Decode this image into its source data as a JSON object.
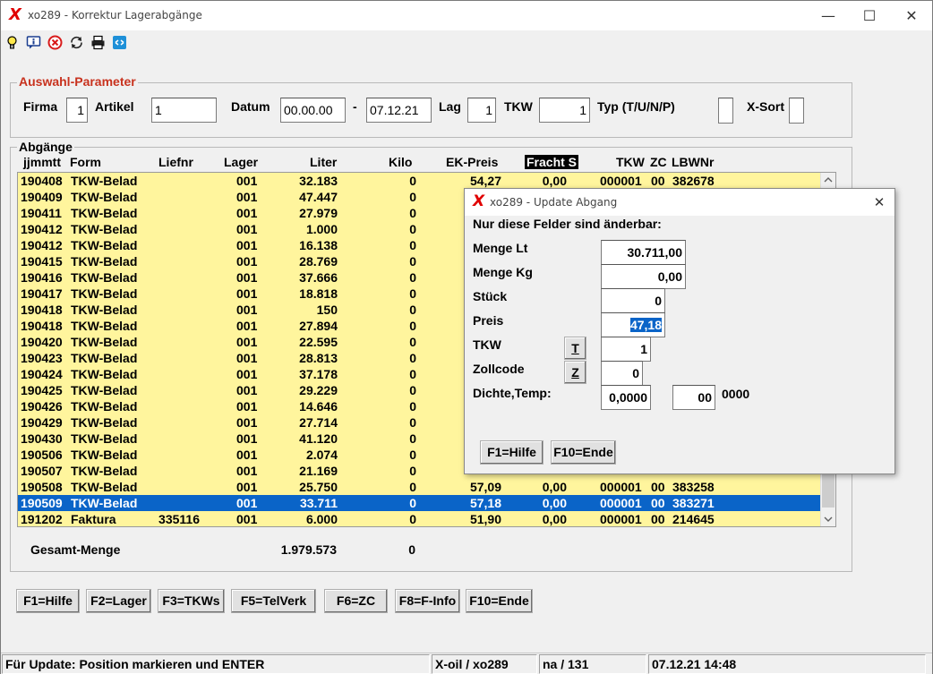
{
  "window": {
    "title": "xo289 - Korrektur Lagerabgänge",
    "logo": "X",
    "controls": {
      "minimize": "—",
      "maximize": "☐",
      "close": "✕"
    }
  },
  "toolbar": {
    "icons": [
      "lightbulb-icon",
      "info-icon",
      "stop-icon",
      "refresh-icon",
      "printer-icon",
      "settings-icon"
    ]
  },
  "auswahl": {
    "title": "Auswahl-Parameter",
    "firma_label": "Firma",
    "firma_value": "1",
    "artikel_label": "Artikel",
    "artikel_value": "1",
    "datum_label": "Datum",
    "datum_from": "00.00.00",
    "datum_sep": "-",
    "datum_to": "07.12.21",
    "lag_label": "Lag",
    "lag_value": "1",
    "tkw_label": "TKW",
    "tkw_value": "1",
    "typ_label": "Typ (T/U/N/P)",
    "typ_value": "",
    "xsort_label": "X-Sort",
    "xsort_value": ""
  },
  "abgaenge": {
    "title": "Abgänge",
    "headers": {
      "date": "jjmmtt",
      "form": "Form",
      "liefnr": "Liefnr",
      "lager": "Lager",
      "liter": "Liter",
      "kilo": "Kilo",
      "ekpreis": "EK-Preis",
      "fracht": "Fracht  S",
      "tkw": "TKW",
      "zc": "ZC",
      "lbwnr": "LBWNr"
    },
    "rows": [
      {
        "date": "190408",
        "form": "TKW-Belad",
        "liefnr": "",
        "lager": "001",
        "liter": "32.183",
        "kilo": "0",
        "ekpreis": "54,27",
        "fracht": "0,00",
        "tkw": "000001",
        "zc": "00",
        "lbwnr": "382678"
      },
      {
        "date": "190409",
        "form": "TKW-Belad",
        "liefnr": "",
        "lager": "001",
        "liter": "47.447",
        "kilo": "0",
        "ekpreis": "",
        "fracht": "",
        "tkw": "",
        "zc": "",
        "lbwnr": ""
      },
      {
        "date": "190411",
        "form": "TKW-Belad",
        "liefnr": "",
        "lager": "001",
        "liter": "27.979",
        "kilo": "0",
        "ekpreis": "",
        "fracht": "",
        "tkw": "",
        "zc": "",
        "lbwnr": ""
      },
      {
        "date": "190412",
        "form": "TKW-Belad",
        "liefnr": "",
        "lager": "001",
        "liter": "1.000",
        "kilo": "0",
        "ekpreis": "",
        "fracht": "",
        "tkw": "",
        "zc": "",
        "lbwnr": ""
      },
      {
        "date": "190412",
        "form": "TKW-Belad",
        "liefnr": "",
        "lager": "001",
        "liter": "16.138",
        "kilo": "0",
        "ekpreis": "",
        "fracht": "",
        "tkw": "",
        "zc": "",
        "lbwnr": ""
      },
      {
        "date": "190415",
        "form": "TKW-Belad",
        "liefnr": "",
        "lager": "001",
        "liter": "28.769",
        "kilo": "0",
        "ekpreis": "",
        "fracht": "",
        "tkw": "",
        "zc": "",
        "lbwnr": ""
      },
      {
        "date": "190416",
        "form": "TKW-Belad",
        "liefnr": "",
        "lager": "001",
        "liter": "37.666",
        "kilo": "0",
        "ekpreis": "",
        "fracht": "",
        "tkw": "",
        "zc": "",
        "lbwnr": ""
      },
      {
        "date": "190417",
        "form": "TKW-Belad",
        "liefnr": "",
        "lager": "001",
        "liter": "18.818",
        "kilo": "0",
        "ekpreis": "",
        "fracht": "",
        "tkw": "",
        "zc": "",
        "lbwnr": ""
      },
      {
        "date": "190418",
        "form": "TKW-Belad",
        "liefnr": "",
        "lager": "001",
        "liter": "150",
        "kilo": "0",
        "ekpreis": "",
        "fracht": "",
        "tkw": "",
        "zc": "",
        "lbwnr": ""
      },
      {
        "date": "190418",
        "form": "TKW-Belad",
        "liefnr": "",
        "lager": "001",
        "liter": "27.894",
        "kilo": "0",
        "ekpreis": "",
        "fracht": "",
        "tkw": "",
        "zc": "",
        "lbwnr": ""
      },
      {
        "date": "190420",
        "form": "TKW-Belad",
        "liefnr": "",
        "lager": "001",
        "liter": "22.595",
        "kilo": "0",
        "ekpreis": "",
        "fracht": "",
        "tkw": "",
        "zc": "",
        "lbwnr": ""
      },
      {
        "date": "190423",
        "form": "TKW-Belad",
        "liefnr": "",
        "lager": "001",
        "liter": "28.813",
        "kilo": "0",
        "ekpreis": "",
        "fracht": "",
        "tkw": "",
        "zc": "",
        "lbwnr": ""
      },
      {
        "date": "190424",
        "form": "TKW-Belad",
        "liefnr": "",
        "lager": "001",
        "liter": "37.178",
        "kilo": "0",
        "ekpreis": "",
        "fracht": "",
        "tkw": "",
        "zc": "",
        "lbwnr": ""
      },
      {
        "date": "190425",
        "form": "TKW-Belad",
        "liefnr": "",
        "lager": "001",
        "liter": "29.229",
        "kilo": "0",
        "ekpreis": "",
        "fracht": "",
        "tkw": "",
        "zc": "",
        "lbwnr": ""
      },
      {
        "date": "190426",
        "form": "TKW-Belad",
        "liefnr": "",
        "lager": "001",
        "liter": "14.646",
        "kilo": "0",
        "ekpreis": "",
        "fracht": "",
        "tkw": "",
        "zc": "",
        "lbwnr": ""
      },
      {
        "date": "190429",
        "form": "TKW-Belad",
        "liefnr": "",
        "lager": "001",
        "liter": "27.714",
        "kilo": "0",
        "ekpreis": "",
        "fracht": "",
        "tkw": "",
        "zc": "",
        "lbwnr": ""
      },
      {
        "date": "190430",
        "form": "TKW-Belad",
        "liefnr": "",
        "lager": "001",
        "liter": "41.120",
        "kilo": "0",
        "ekpreis": "",
        "fracht": "",
        "tkw": "",
        "zc": "",
        "lbwnr": ""
      },
      {
        "date": "190506",
        "form": "TKW-Belad",
        "liefnr": "",
        "lager": "001",
        "liter": "2.074",
        "kilo": "0",
        "ekpreis": "",
        "fracht": "",
        "tkw": "",
        "zc": "",
        "lbwnr": ""
      },
      {
        "date": "190507",
        "form": "TKW-Belad",
        "liefnr": "",
        "lager": "001",
        "liter": "21.169",
        "kilo": "0",
        "ekpreis": "",
        "fracht": "",
        "tkw": "",
        "zc": "",
        "lbwnr": ""
      },
      {
        "date": "190508",
        "form": "TKW-Belad",
        "liefnr": "",
        "lager": "001",
        "liter": "25.750",
        "kilo": "0",
        "ekpreis": "57,09",
        "fracht": "0,00",
        "tkw": "000001",
        "zc": "00",
        "lbwnr": "383258"
      },
      {
        "date": "190509",
        "form": "TKW-Belad",
        "liefnr": "",
        "lager": "001",
        "liter": "33.711",
        "kilo": "0",
        "ekpreis": "57,18",
        "fracht": "0,00",
        "tkw": "000001",
        "zc": "00",
        "lbwnr": "383271",
        "selected": true
      },
      {
        "date": "191202",
        "form": "Faktura",
        "liefnr": "335116",
        "lager": "001",
        "liter": "6.000",
        "kilo": "0",
        "ekpreis": "51,90",
        "fracht": "0,00",
        "tkw": "000001",
        "zc": "00",
        "lbwnr": "214645"
      }
    ],
    "total_label": "Gesamt-Menge",
    "total_liter": "1.979.573",
    "total_kilo": "0"
  },
  "buttons": [
    "F1=Hilfe",
    "F2=Lager",
    "F3=TKWs",
    "F5=TelVerk",
    "F6=ZC",
    "F8=F-Info",
    "F10=Ende"
  ],
  "statusbar": {
    "message": "Für Update: Position markieren und ENTER",
    "app": "X-oil / xo289",
    "user": "na / 131",
    "datetime": "07.12.21 14:48"
  },
  "dialog": {
    "title": "xo289 - Update Abgang",
    "logo": "X",
    "close": "✕",
    "heading": "Nur diese Felder sind änderbar:",
    "menge_lt_label": "Menge  Lt",
    "menge_lt_value": "30.711,00",
    "menge_kg_label": "Menge  Kg",
    "menge_kg_value": "0,00",
    "stueck_label": "Stück",
    "stueck_value": "0",
    "preis_label": "Preis",
    "preis_value": "47,18",
    "tkw_label": "TKW",
    "tkw_button": "T",
    "tkw_value": "1",
    "zollcode_label": "Zollcode",
    "zollcode_button": "Z",
    "zollcode_value": "0",
    "dichte_label": "Dichte,Temp:",
    "dichte_value": "0,0000",
    "temp_value": "00",
    "temp_extra": "0000",
    "btn_hilfe": "F1=Hilfe",
    "btn_ende": "F10=Ende"
  },
  "colors": {
    "row_bg": "#fff59d",
    "selected_bg": "#0a64c8",
    "group_title": "#c8321e",
    "logo": "#e00000"
  }
}
